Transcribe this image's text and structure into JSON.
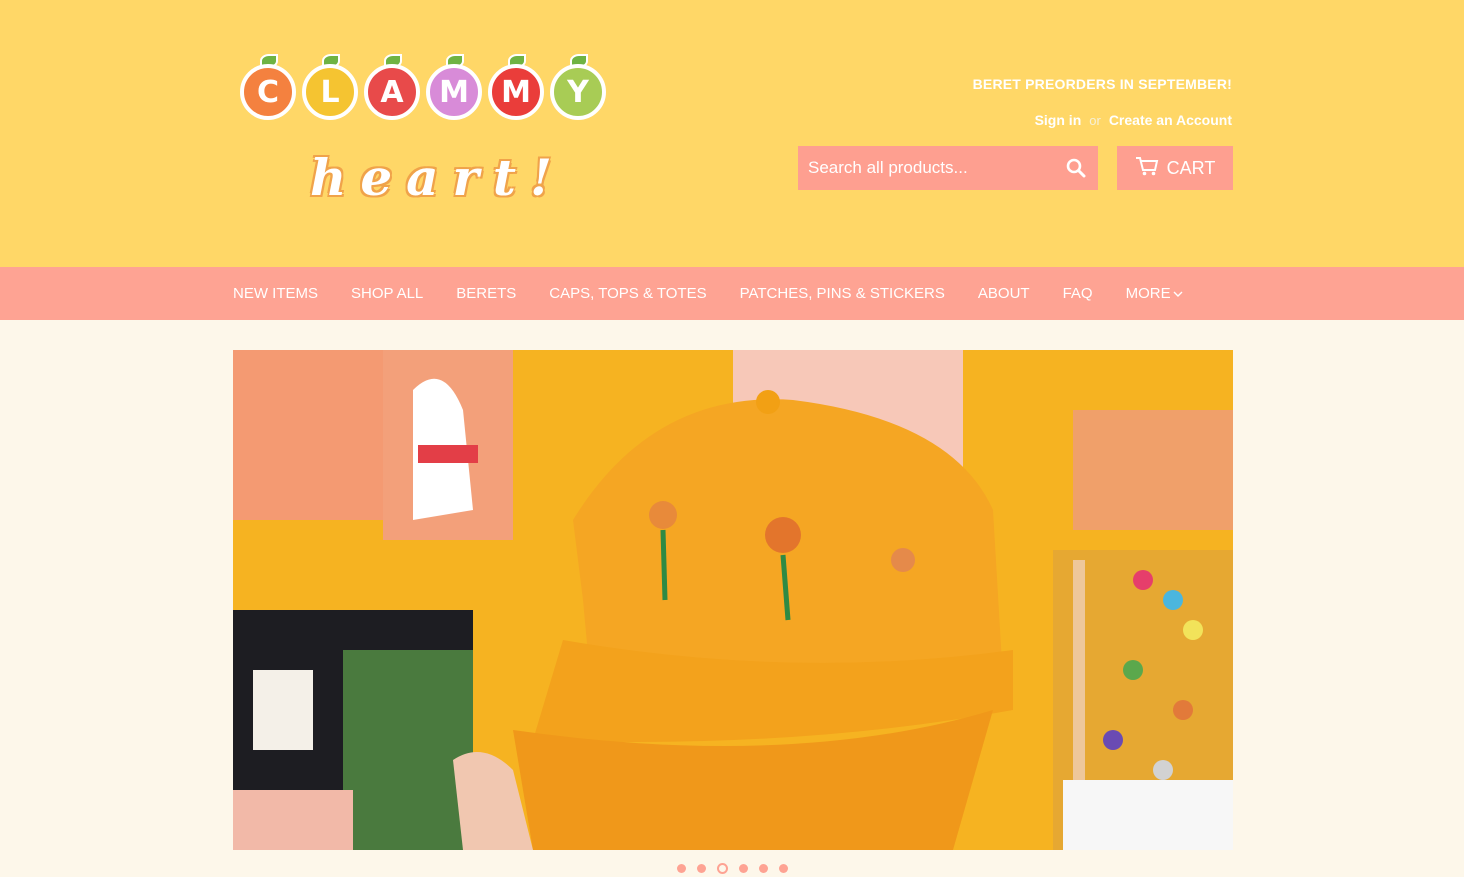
{
  "brand": {
    "logo_letters": [
      "C",
      "L",
      "A",
      "M",
      "M",
      "Y"
    ],
    "logo_letter_colors": [
      "#f4813f",
      "#f5c431",
      "#e84a4a",
      "#d88bd8",
      "#ea3d3a",
      "#a8cc55"
    ],
    "logo_script": "heart!"
  },
  "header": {
    "announcement": "BERET PREORDERS IN SEPTEMBER!",
    "sign_in": "Sign in",
    "or": "or",
    "create_account": "Create an Account",
    "search_placeholder": "Search all products...",
    "cart_label": "CART",
    "bg_color": "#ffd767",
    "accent_color": "#fea393"
  },
  "nav": {
    "items": [
      {
        "label": "NEW ITEMS"
      },
      {
        "label": "SHOP ALL"
      },
      {
        "label": "BERETS"
      },
      {
        "label": "CAPS, TOPS & TOTES"
      },
      {
        "label": "PATCHES, PINS & STICKERS"
      },
      {
        "label": "ABOUT"
      },
      {
        "label": "FAQ"
      },
      {
        "label": "MORE"
      }
    ]
  },
  "slideshow": {
    "slide_count": 6,
    "active_index": 2
  }
}
